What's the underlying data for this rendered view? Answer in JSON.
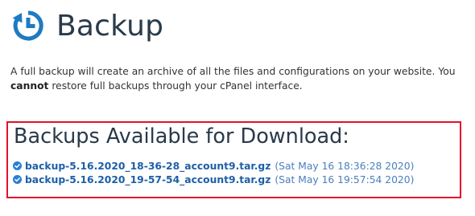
{
  "header": {
    "title": "Backup",
    "icon": "backup-clock-icon",
    "icon_color": "#1e7bc1"
  },
  "intro": {
    "line1": "A full backup will create an archive of all the files and configurations on your website. You",
    "line2_strong": "cannot",
    "line2_rest": " restore full backups through your cPanel interface."
  },
  "downloads": {
    "heading": "Backups Available for Download:",
    "highlight_color": "#e3112c",
    "items": [
      {
        "icon": "check-circle-icon",
        "filename": "backup-5.16.2020_18-36-28_account9.tar.gz",
        "date": "(Sat May 16 18:36:28 2020)"
      },
      {
        "icon": "check-circle-icon",
        "filename": "backup-5.16.2020_19-57-54_account9.tar.gz",
        "date": "(Sat May 16 19:57:54 2020)"
      }
    ]
  },
  "colors": {
    "link": "#1d5fa6",
    "date": "#4a7fbf",
    "title": "#293a4a",
    "check": "#2a7fd4"
  }
}
